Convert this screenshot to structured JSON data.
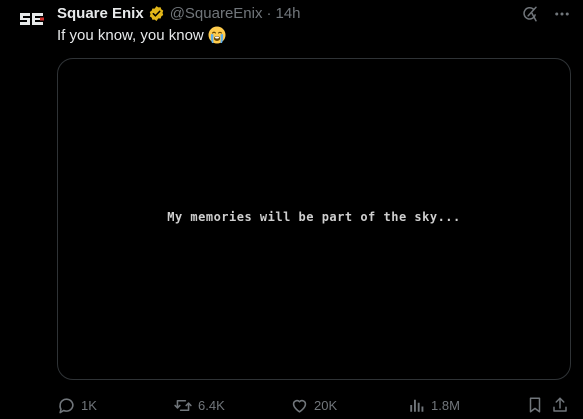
{
  "tweet": {
    "author_name": "Square Enix",
    "handle": "@SquareEnix",
    "separator": "·",
    "time": "14h",
    "text": "If you know, you know",
    "avatar_label": "SE",
    "media_caption": "My memories will be part of the sky..."
  },
  "actions": {
    "replies": "1K",
    "reposts": "6.4K",
    "likes": "20K",
    "views": "1.8M"
  },
  "colors": {
    "background": "#000000",
    "text": "#e7e9ea",
    "muted": "#71767b",
    "verified": "#e2b719",
    "border": "#2f3336"
  }
}
